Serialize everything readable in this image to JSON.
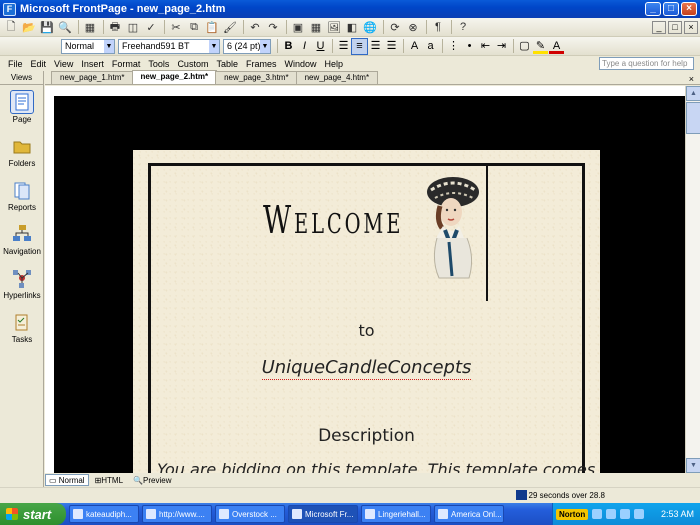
{
  "window": {
    "title": "Microsoft FrontPage - new_page_2.htm",
    "minimize": "_",
    "maximize": "□",
    "close": "×"
  },
  "toolbar_format": {
    "style": "Normal",
    "font": "Freehand591 BT",
    "size": "6 (24 pt)",
    "bold": "B",
    "italic": "I",
    "underline": "U"
  },
  "menubar": {
    "items": [
      "File",
      "Edit",
      "View",
      "Insert",
      "Format",
      "Tools",
      "Custom",
      "Table",
      "Frames",
      "Window",
      "Help"
    ],
    "help_placeholder": "Type a question for help"
  },
  "views": {
    "header": "Views",
    "items": [
      {
        "label": "Page",
        "icon": "page-view-icon",
        "color": "#2f6fd6"
      },
      {
        "label": "Folders",
        "icon": "folders-icon",
        "color": "#e0b73a"
      },
      {
        "label": "Reports",
        "icon": "reports-icon",
        "color": "#4a7fc8"
      },
      {
        "label": "Navigation",
        "icon": "navigation-icon",
        "color": "#c89d2a"
      },
      {
        "label": "Hyperlinks",
        "icon": "hyperlinks-icon",
        "color": "#6f8fc0"
      },
      {
        "label": "Tasks",
        "icon": "tasks-icon",
        "color": "#b07e2a"
      }
    ]
  },
  "tabs": [
    {
      "label": "new_page_1.htm*"
    },
    {
      "label": "new_page_2.htm*"
    },
    {
      "label": "new_page_3.htm*"
    },
    {
      "label": "new_page_4.htm*"
    }
  ],
  "tab_close": "×",
  "page": {
    "welcome": "Welcome",
    "to": "to",
    "company": "UniqueCandleConcepts",
    "description": "Description",
    "body": "You are bidding on this template. This template comes with no right"
  },
  "modes": [
    "Normal",
    "HTML",
    "Preview"
  ],
  "status": {
    "download": "29 seconds over 28.8"
  },
  "taskbar": {
    "start": "start",
    "tasks": [
      "kateaudiph...",
      "http://www....",
      "Overstock ...",
      "Microsoft Fr...",
      "Lingeriehall...",
      "America Onl...",
      "Norton"
    ],
    "clock": "2:53 AM"
  }
}
